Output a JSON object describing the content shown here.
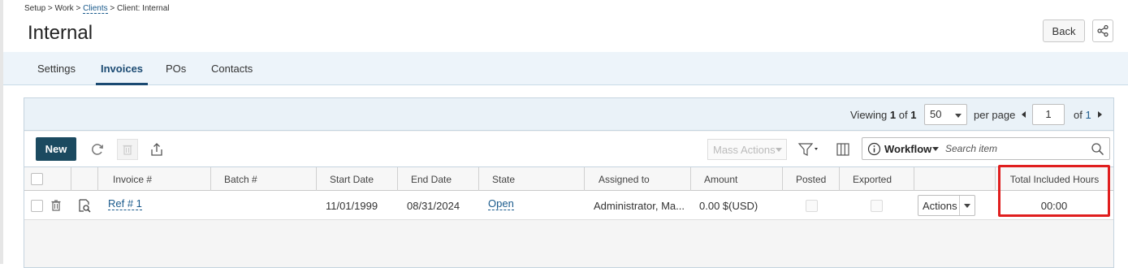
{
  "breadcrumb": {
    "part1": "Setup > Work > ",
    "link": "Clients",
    "part2": " > Client: Internal"
  },
  "page_title": "Internal",
  "header": {
    "back_label": "Back",
    "share_icon": "share-icon"
  },
  "tabs": [
    {
      "label": "Settings",
      "active": false
    },
    {
      "label": "Invoices",
      "active": true
    },
    {
      "label": "POs",
      "active": false
    },
    {
      "label": "Contacts",
      "active": false
    }
  ],
  "pager": {
    "viewing_label": "Viewing",
    "current": "1",
    "of_label": "of",
    "total": "1",
    "per_page_value": "50",
    "per_page_label": "per page",
    "page_input": "1",
    "of_pages_label": "of",
    "total_pages": "1"
  },
  "toolbar": {
    "new_label": "New",
    "mass_actions_label": "Mass Actions",
    "workflow_label": "Workflow",
    "search_placeholder": "Search item"
  },
  "columns": [
    "Invoice #",
    "Batch #",
    "Start Date",
    "End Date",
    "State",
    "Assigned to",
    "Amount",
    "Posted",
    "Exported",
    "",
    "Total Included Hours"
  ],
  "rows": [
    {
      "invoice": "Ref # 1",
      "batch": "",
      "start_date": "11/01/1999",
      "end_date": "08/31/2024",
      "state": "Open",
      "assigned_to": "Administrator, Ma...",
      "amount": "0.00 $(USD)",
      "posted": false,
      "exported": false,
      "actions_label": "Actions",
      "total_included_hours": "00:00"
    }
  ],
  "colors": {
    "accent": "#1b4a72",
    "new_button": "#1b4a60",
    "highlight": "#e01e1e",
    "link": "#1a5a8c"
  }
}
